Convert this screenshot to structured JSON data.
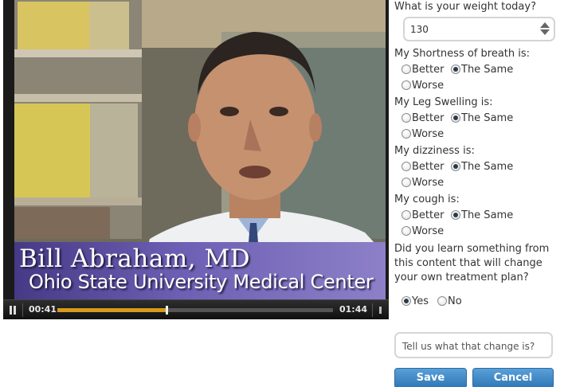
{
  "video": {
    "lower_third_name": "Bill Abraham, MD",
    "lower_third_org": "Ohio State University Medical Center",
    "current_time": "00:41",
    "duration": "01:44",
    "progress_fraction": 0.395,
    "icons": [
      "pause-icon",
      "volume-icon"
    ]
  },
  "form": {
    "weight": {
      "question": "What is your weight today?",
      "value": "130"
    },
    "symptoms": [
      {
        "question": "My Shortness of breath is:",
        "options": [
          "Better",
          "The Same",
          "Worse"
        ],
        "selected": "The Same"
      },
      {
        "question": "My Leg Swelling is:",
        "options": [
          "Better",
          "The Same",
          "Worse"
        ],
        "selected": "The Same"
      },
      {
        "question": "My dizziness is:",
        "options": [
          "Better",
          "The Same",
          "Worse"
        ],
        "selected": "The Same"
      },
      {
        "question": "My cough is:",
        "options": [
          "Better",
          "The Same",
          "Worse"
        ],
        "selected": "The Same"
      }
    ],
    "learn": {
      "question": "Did you learn something from this content that will change your own treatment plan?",
      "options": [
        "Yes",
        "No"
      ],
      "selected": "Yes"
    },
    "change_placeholder": "Tell us what that change is?",
    "save_label": "Save",
    "cancel_label": "Cancel"
  },
  "colors": {
    "button": "#3b86c6",
    "progress": "#d69a1c",
    "lower_third": "#5a4ca0"
  }
}
